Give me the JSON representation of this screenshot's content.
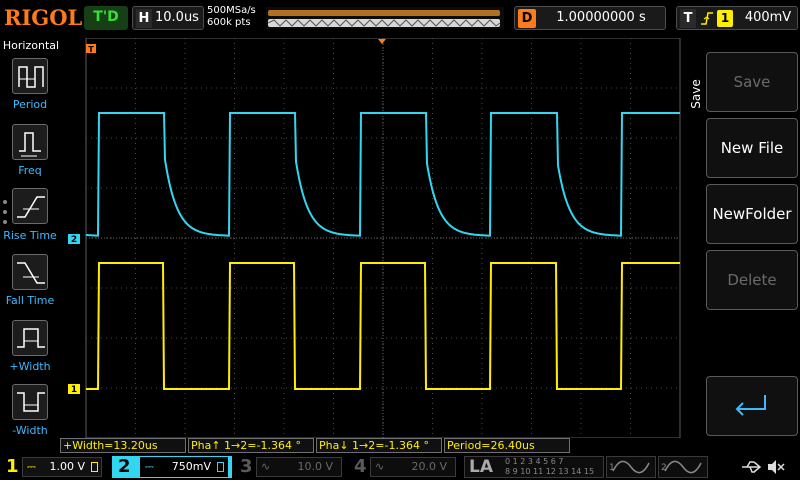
{
  "colors": {
    "ch1": "#ffee00",
    "ch2": "#33d6f0",
    "accent": "#ff7a1a",
    "trigger_state": "#34e034",
    "label_blue": "#3fb8ff"
  },
  "header": {
    "brand": "RIGOL",
    "trigger_status": "T'D",
    "horizontal": {
      "label": "H",
      "timebase": "10.0us"
    },
    "sample_rate": "500MSa/s",
    "memory_depth": "600k pts",
    "delay": {
      "label": "D",
      "value": "1.00000000 s"
    },
    "trigger": {
      "label": "T",
      "slope_icon": "rising-edge-icon",
      "source": "1",
      "level": "400mV"
    }
  },
  "left_panel": {
    "title": "Horizontal",
    "items": [
      {
        "label": "Period",
        "icon": "period-icon"
      },
      {
        "label": "Freq",
        "icon": "freq-icon"
      },
      {
        "label": "Rise Time",
        "icon": "rise-time-icon"
      },
      {
        "label": "Fall Time",
        "icon": "fall-time-icon"
      },
      {
        "label": "+Width",
        "icon": "pos-width-icon"
      },
      {
        "label": "-Width",
        "icon": "neg-width-icon"
      }
    ]
  },
  "right_panel": {
    "title": "Save",
    "buttons": [
      {
        "label": "Save",
        "enabled": false
      },
      {
        "label": "New File",
        "enabled": true
      },
      {
        "label": "NewFolder",
        "enabled": true
      },
      {
        "label": "Delete",
        "enabled": false
      },
      {
        "label": "",
        "icon": "enter-return-icon",
        "enabled": true
      }
    ]
  },
  "waveform_markers": {
    "trigger_tag": "T",
    "ch1_tag": "1",
    "ch2_tag": "2",
    "trig_level_tag": "T"
  },
  "measurements": [
    {
      "text": "+Width=13.20us"
    },
    {
      "text": "Pha↑ 1→2=-1.364 °"
    },
    {
      "text": "Pha↓ 1→2=-1.364 °"
    },
    {
      "text": "Period=26.40us"
    }
  ],
  "bottom_bar": {
    "channels": [
      {
        "num": "1",
        "coupling": "⎓",
        "scale": "1.00 V"
      },
      {
        "num": "2",
        "coupling": "⎓",
        "scale": "750mV"
      },
      {
        "num": "3",
        "coupling": "∿",
        "scale": "10.0 V"
      },
      {
        "num": "4",
        "coupling": "∿",
        "scale": "20.0 V"
      }
    ],
    "la": "LA",
    "la_bits_top": "0 1 2 3   4 5 6 7",
    "la_bits_bottom": "8 9 10 11 12 13 14 15",
    "gen1": "1",
    "gen2": "2"
  },
  "waveform": {
    "period_us": 26.4,
    "positive_width_us": 13.2,
    "timebase_us_per_div": 10.0,
    "ch1_shape": "square",
    "ch2_shape": "exponential-decay square"
  }
}
